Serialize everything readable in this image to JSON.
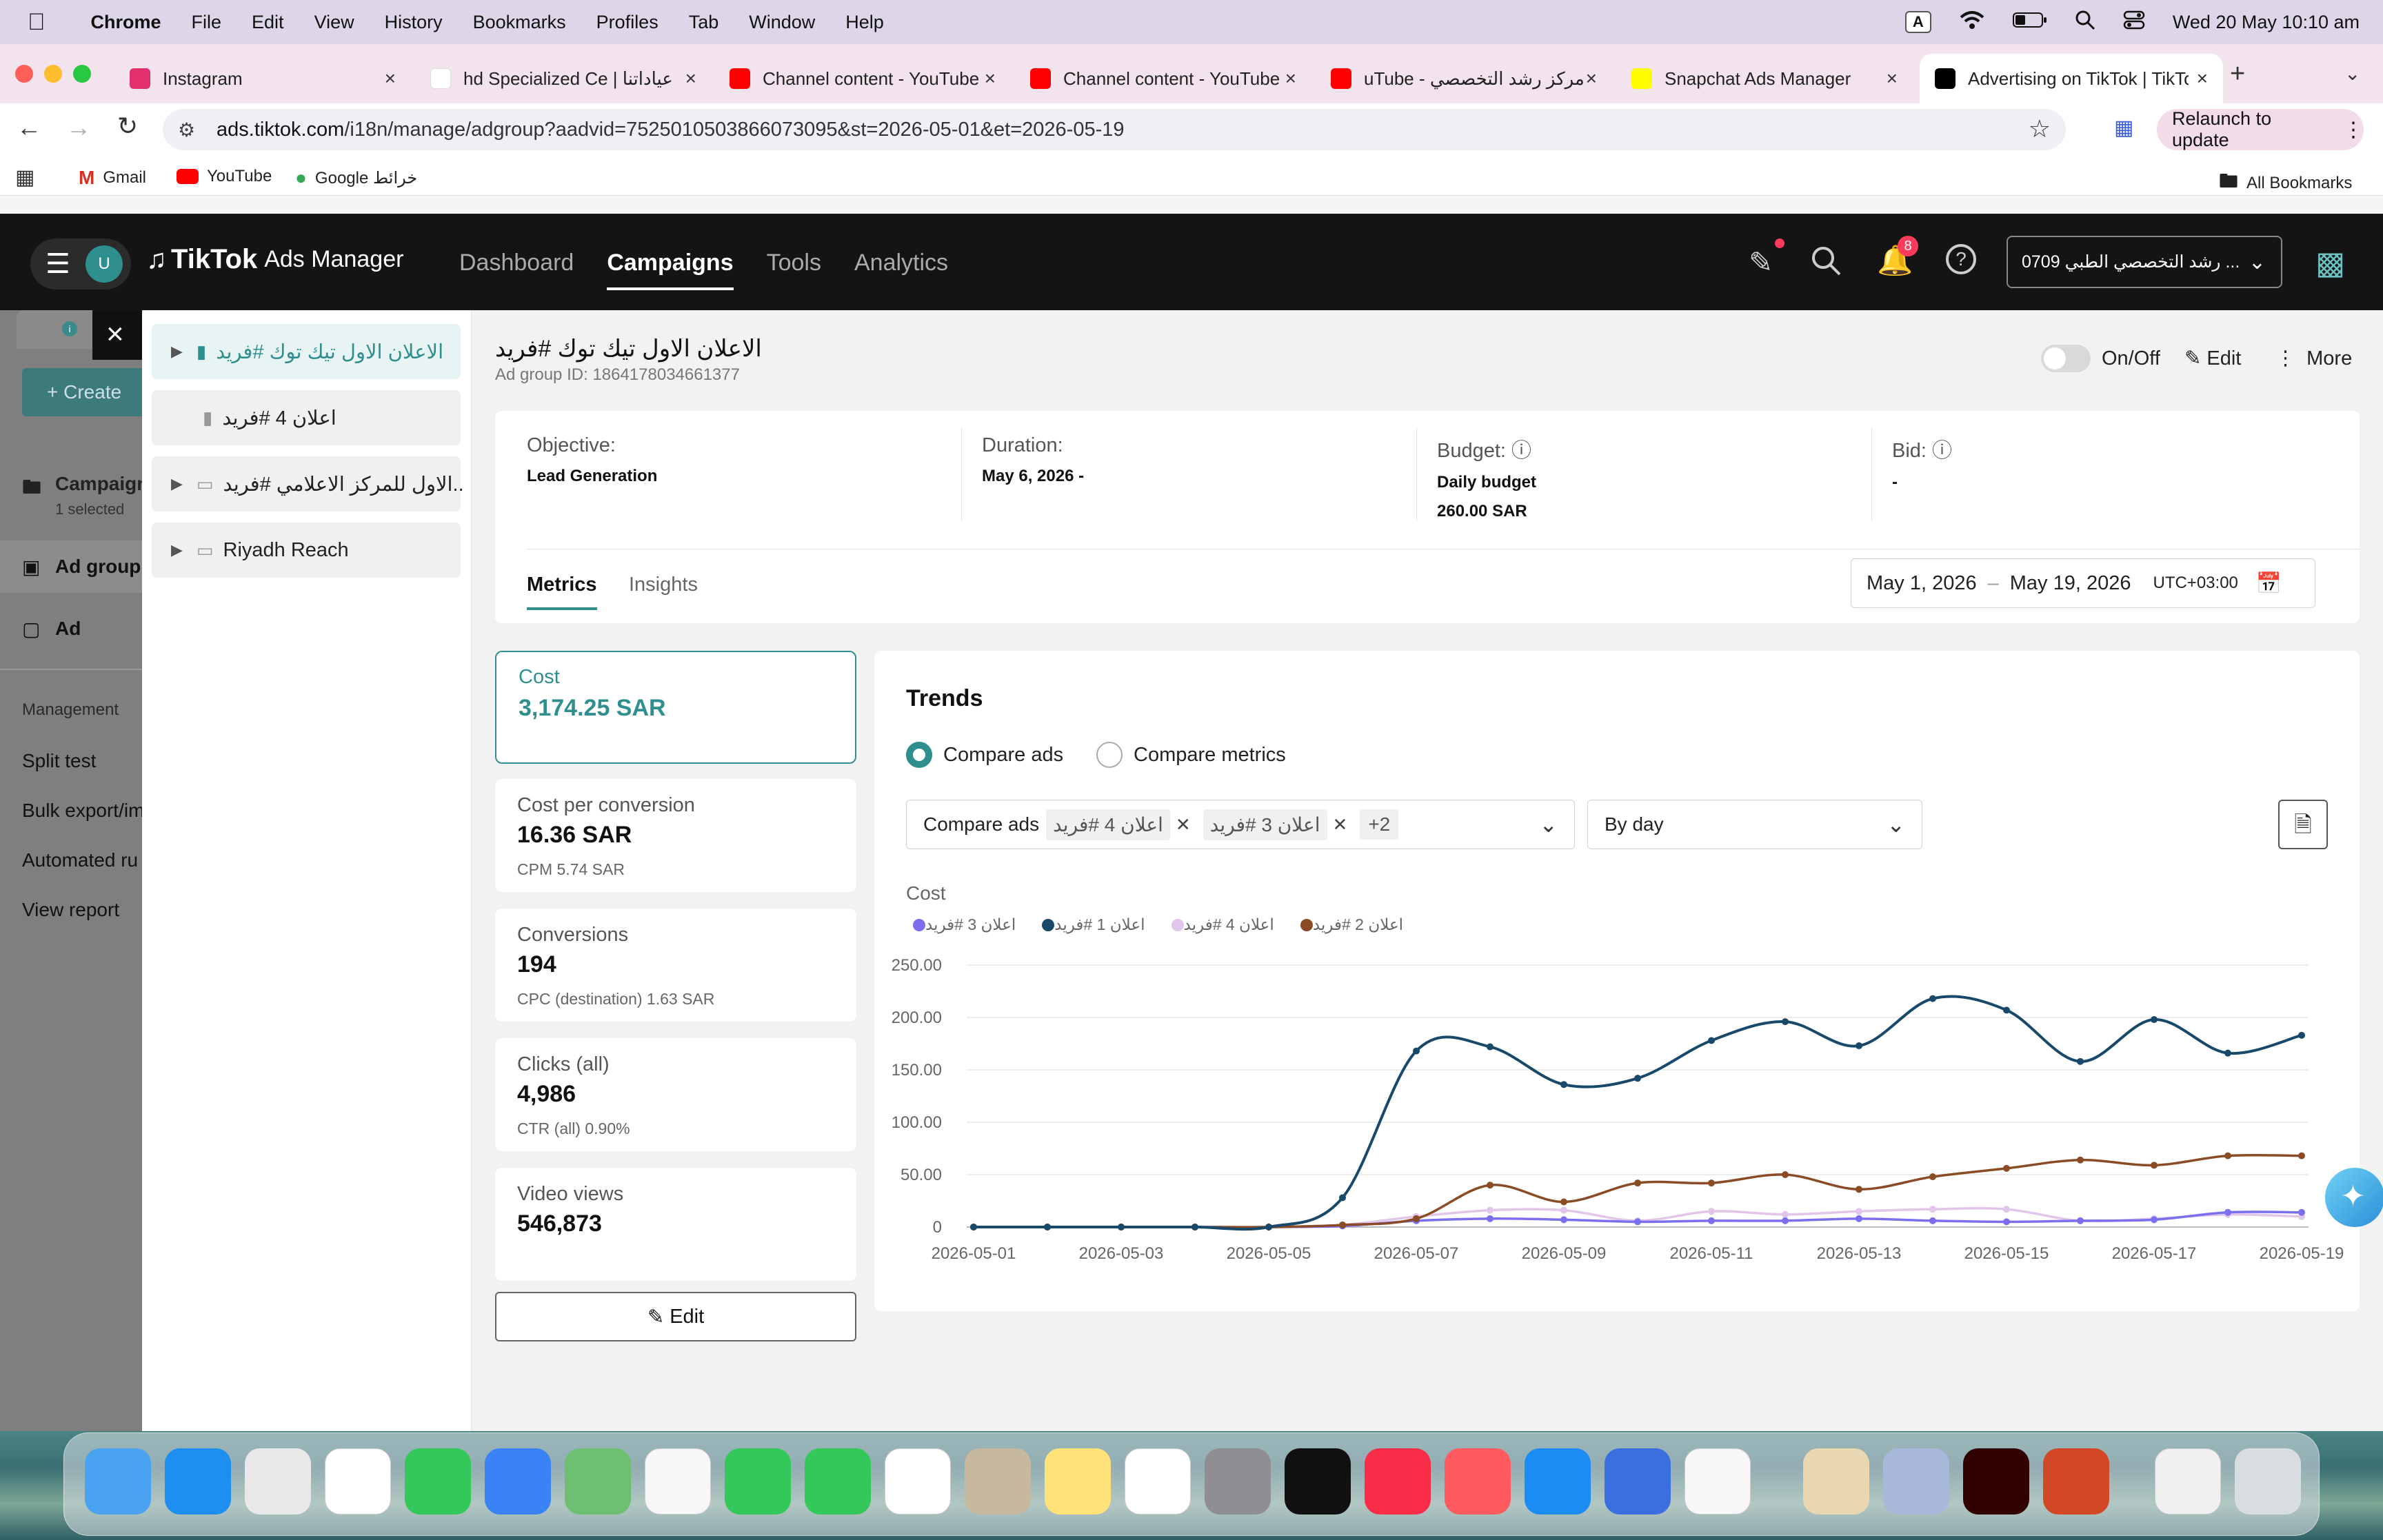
{
  "menubar": {
    "app": "Chrome",
    "items": [
      "File",
      "Edit",
      "View",
      "History",
      "Bookmarks",
      "Profiles",
      "Tab",
      "Window",
      "Help"
    ],
    "input_source": "A",
    "datetime": "Wed 20 May  10:10 am"
  },
  "tabs": [
    {
      "title": "Instagram",
      "icon": "instagram-icon",
      "color": "#e1306c"
    },
    {
      "title": "hd Specialized Ce | عياداتنا",
      "icon": "blank-icon",
      "color": "#ffffff"
    },
    {
      "title": "Channel content - YouTube",
      "icon": "youtube-icon",
      "color": "#ff0000"
    },
    {
      "title": "Channel content - YouTube",
      "icon": "youtube-icon",
      "color": "#ff0000"
    },
    {
      "title": "uTube - مركز رشد التخصصي",
      "icon": "youtube-icon",
      "color": "#ff0000"
    },
    {
      "title": "Snapchat Ads Manager",
      "icon": "snapchat-icon",
      "color": "#fffc00"
    },
    {
      "title": "Advertising on TikTok | TikTok",
      "icon": "tiktok-icon",
      "color": "#000000"
    }
  ],
  "url": {
    "host": "ads.tiktok.com",
    "path": "/i18n/manage/adgroup?aadvid=7525010503866073095&st=2026-05-01&et=2026-05-19"
  },
  "relaunch": "Relaunch to update",
  "bookmarks": {
    "items": [
      "Gmail",
      "YouTube",
      "Google خرائط"
    ],
    "all": "All Bookmarks"
  },
  "tiktok": {
    "avatar": "U",
    "brand": "TikTok",
    "brand_suffix": "Ads Manager",
    "nav": [
      "Dashboard",
      "Campaigns",
      "Tools",
      "Analytics"
    ],
    "notif_count": "8",
    "account": "0709 رشد التخصصي الطبي ..."
  },
  "sidebar": {
    "create": "+ Create",
    "campaign": "Campaign",
    "campaign_sub": "1 selected",
    "adgroup": "Ad group",
    "ad": "Ad",
    "management": "Management",
    "links": [
      "Split test",
      "Bulk export/im",
      "Automated ru",
      "View report"
    ]
  },
  "tree": {
    "items": [
      "الاعلان الاول تيك توك #فريد",
      "اعلان 4 #فريد",
      "..الاول للمركز الاعلامي #فريد",
      "Riyadh Reach"
    ]
  },
  "adgroup": {
    "title": "الاعلان الاول تيك توك #فريد",
    "id_label": "Ad group ID: 1864178034661377",
    "onoff": "On/Off",
    "edit": "Edit",
    "more": "More"
  },
  "info": {
    "objective_label": "Objective:",
    "objective": "Lead Generation",
    "duration_label": "Duration:",
    "duration": "May 6, 2026 -",
    "budget_label": "Budget:",
    "budget_type": "Daily budget",
    "budget": "260.00 SAR",
    "bid_label": "Bid:",
    "bid": "-"
  },
  "tabs2": {
    "metrics": "Metrics",
    "insights": "Insights"
  },
  "daterange": {
    "start": "May 1, 2026",
    "sep": "–",
    "end": "May 19, 2026",
    "tz": "UTC+03:00"
  },
  "metrics": [
    {
      "label": "Cost",
      "value": "3,174.25 SAR",
      "sub": ""
    },
    {
      "label": "Cost per conversion",
      "value": "16.36 SAR",
      "sub": "CPM 5.74 SAR"
    },
    {
      "label": "Conversions",
      "value": "194",
      "sub": "CPC (destination) 1.63 SAR"
    },
    {
      "label": "Clicks (all)",
      "value": "4,986",
      "sub": "CTR (all) 0.90%"
    },
    {
      "label": "Video views",
      "value": "546,873",
      "sub": ""
    }
  ],
  "edit_button": "Edit",
  "trends": {
    "title": "Trends",
    "radio1": "Compare ads",
    "radio2": "Compare metrics",
    "select_label": "Compare ads",
    "chips": [
      "اعلان 4 #فريد",
      "اعلان 3 #فريد"
    ],
    "more_chip": "+2",
    "granularity": "By day",
    "metric": "Cost"
  },
  "chart_data": {
    "type": "line",
    "ylabel": "Cost",
    "ylim": [
      0,
      250
    ],
    "yticks": [
      "250.00",
      "200.00",
      "150.00",
      "100.00",
      "50.00",
      "0"
    ],
    "x": [
      "2026-05-01",
      "2026-05-02",
      "2026-05-03",
      "2026-05-04",
      "2026-05-05",
      "2026-05-06",
      "2026-05-07",
      "2026-05-08",
      "2026-05-09",
      "2026-05-10",
      "2026-05-11",
      "2026-05-12",
      "2026-05-13",
      "2026-05-14",
      "2026-05-15",
      "2026-05-16",
      "2026-05-17",
      "2026-05-18",
      "2026-05-19"
    ],
    "xticks": [
      "2026-05-01",
      "2026-05-03",
      "2026-05-05",
      "2026-05-07",
      "2026-05-09",
      "2026-05-11",
      "2026-05-13",
      "2026-05-15",
      "2026-05-17",
      "2026-05-19"
    ],
    "series": [
      {
        "name": "اعلان 3 #فريد",
        "color": "#7b6ff0",
        "values": [
          0,
          0,
          0,
          0,
          0,
          1,
          6,
          8,
          7,
          5,
          6,
          6,
          8,
          6,
          5,
          6,
          7,
          14,
          14
        ]
      },
      {
        "name": "اعلان 1 #فريد",
        "color": "#18496b",
        "values": [
          0,
          0,
          0,
          0,
          0,
          28,
          168,
          172,
          136,
          142,
          178,
          196,
          173,
          218,
          207,
          158,
          198,
          166,
          183
        ]
      },
      {
        "name": "اعلان 4 #فريد",
        "color": "#e2c6ea",
        "values": [
          0,
          0,
          0,
          0,
          0,
          2,
          10,
          16,
          16,
          6,
          15,
          12,
          15,
          17,
          17,
          6,
          8,
          12,
          10
        ]
      },
      {
        "name": "اعلان 2 #فريد",
        "color": "#8a4b25",
        "values": [
          0,
          0,
          0,
          0,
          0,
          2,
          8,
          40,
          24,
          42,
          42,
          50,
          36,
          48,
          56,
          64,
          59,
          68,
          68
        ]
      }
    ]
  },
  "colors": {
    "accent": "#2f8f8f",
    "tiktok_header": "#141414"
  }
}
